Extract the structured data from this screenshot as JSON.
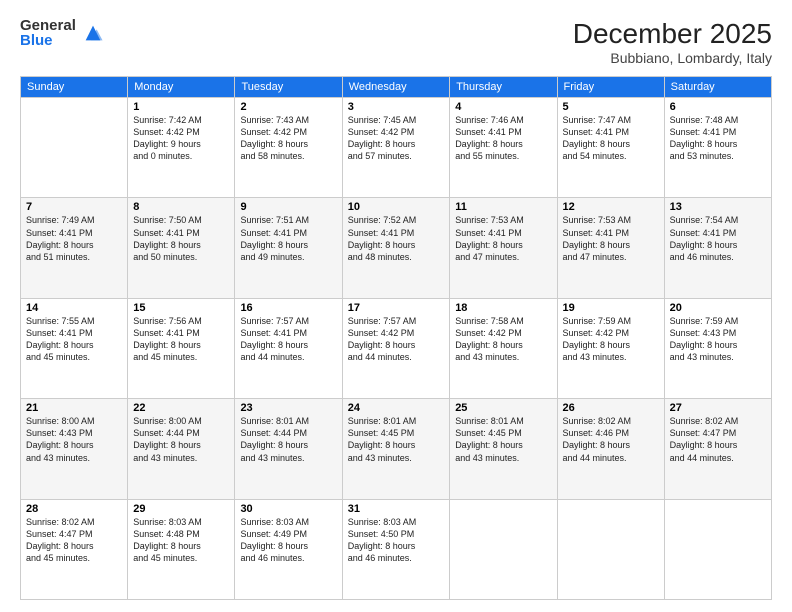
{
  "logo": {
    "general": "General",
    "blue": "Blue"
  },
  "header": {
    "month": "December 2025",
    "location": "Bubbiano, Lombardy, Italy"
  },
  "days": [
    "Sunday",
    "Monday",
    "Tuesday",
    "Wednesday",
    "Thursday",
    "Friday",
    "Saturday"
  ],
  "weeks": [
    [
      {
        "day": "",
        "sun": "",
        "mon": "",
        "tue": "",
        "wed": "",
        "thu": "",
        "fri": "",
        "sat": ""
      },
      {
        "num": "1",
        "lines": [
          "Sunrise: 7:42 AM",
          "Sunset: 4:42 PM",
          "Daylight: 9 hours",
          "and 0 minutes."
        ]
      },
      {
        "num": "2",
        "lines": [
          "Sunrise: 7:43 AM",
          "Sunset: 4:42 PM",
          "Daylight: 8 hours",
          "and 58 minutes."
        ]
      },
      {
        "num": "3",
        "lines": [
          "Sunrise: 7:45 AM",
          "Sunset: 4:42 PM",
          "Daylight: 8 hours",
          "and 57 minutes."
        ]
      },
      {
        "num": "4",
        "lines": [
          "Sunrise: 7:46 AM",
          "Sunset: 4:41 PM",
          "Daylight: 8 hours",
          "and 55 minutes."
        ]
      },
      {
        "num": "5",
        "lines": [
          "Sunrise: 7:47 AM",
          "Sunset: 4:41 PM",
          "Daylight: 8 hours",
          "and 54 minutes."
        ]
      },
      {
        "num": "6",
        "lines": [
          "Sunrise: 7:48 AM",
          "Sunset: 4:41 PM",
          "Daylight: 8 hours",
          "and 53 minutes."
        ]
      }
    ],
    [
      {
        "num": "7",
        "lines": [
          "Sunrise: 7:49 AM",
          "Sunset: 4:41 PM",
          "Daylight: 8 hours",
          "and 51 minutes."
        ]
      },
      {
        "num": "8",
        "lines": [
          "Sunrise: 7:50 AM",
          "Sunset: 4:41 PM",
          "Daylight: 8 hours",
          "and 50 minutes."
        ]
      },
      {
        "num": "9",
        "lines": [
          "Sunrise: 7:51 AM",
          "Sunset: 4:41 PM",
          "Daylight: 8 hours",
          "and 49 minutes."
        ]
      },
      {
        "num": "10",
        "lines": [
          "Sunrise: 7:52 AM",
          "Sunset: 4:41 PM",
          "Daylight: 8 hours",
          "and 48 minutes."
        ]
      },
      {
        "num": "11",
        "lines": [
          "Sunrise: 7:53 AM",
          "Sunset: 4:41 PM",
          "Daylight: 8 hours",
          "and 47 minutes."
        ]
      },
      {
        "num": "12",
        "lines": [
          "Sunrise: 7:53 AM",
          "Sunset: 4:41 PM",
          "Daylight: 8 hours",
          "and 47 minutes."
        ]
      },
      {
        "num": "13",
        "lines": [
          "Sunrise: 7:54 AM",
          "Sunset: 4:41 PM",
          "Daylight: 8 hours",
          "and 46 minutes."
        ]
      }
    ],
    [
      {
        "num": "14",
        "lines": [
          "Sunrise: 7:55 AM",
          "Sunset: 4:41 PM",
          "Daylight: 8 hours",
          "and 45 minutes."
        ]
      },
      {
        "num": "15",
        "lines": [
          "Sunrise: 7:56 AM",
          "Sunset: 4:41 PM",
          "Daylight: 8 hours",
          "and 45 minutes."
        ]
      },
      {
        "num": "16",
        "lines": [
          "Sunrise: 7:57 AM",
          "Sunset: 4:41 PM",
          "Daylight: 8 hours",
          "and 44 minutes."
        ]
      },
      {
        "num": "17",
        "lines": [
          "Sunrise: 7:57 AM",
          "Sunset: 4:42 PM",
          "Daylight: 8 hours",
          "and 44 minutes."
        ]
      },
      {
        "num": "18",
        "lines": [
          "Sunrise: 7:58 AM",
          "Sunset: 4:42 PM",
          "Daylight: 8 hours",
          "and 43 minutes."
        ]
      },
      {
        "num": "19",
        "lines": [
          "Sunrise: 7:59 AM",
          "Sunset: 4:42 PM",
          "Daylight: 8 hours",
          "and 43 minutes."
        ]
      },
      {
        "num": "20",
        "lines": [
          "Sunrise: 7:59 AM",
          "Sunset: 4:43 PM",
          "Daylight: 8 hours",
          "and 43 minutes."
        ]
      }
    ],
    [
      {
        "num": "21",
        "lines": [
          "Sunrise: 8:00 AM",
          "Sunset: 4:43 PM",
          "Daylight: 8 hours",
          "and 43 minutes."
        ]
      },
      {
        "num": "22",
        "lines": [
          "Sunrise: 8:00 AM",
          "Sunset: 4:44 PM",
          "Daylight: 8 hours",
          "and 43 minutes."
        ]
      },
      {
        "num": "23",
        "lines": [
          "Sunrise: 8:01 AM",
          "Sunset: 4:44 PM",
          "Daylight: 8 hours",
          "and 43 minutes."
        ]
      },
      {
        "num": "24",
        "lines": [
          "Sunrise: 8:01 AM",
          "Sunset: 4:45 PM",
          "Daylight: 8 hours",
          "and 43 minutes."
        ]
      },
      {
        "num": "25",
        "lines": [
          "Sunrise: 8:01 AM",
          "Sunset: 4:45 PM",
          "Daylight: 8 hours",
          "and 43 minutes."
        ]
      },
      {
        "num": "26",
        "lines": [
          "Sunrise: 8:02 AM",
          "Sunset: 4:46 PM",
          "Daylight: 8 hours",
          "and 44 minutes."
        ]
      },
      {
        "num": "27",
        "lines": [
          "Sunrise: 8:02 AM",
          "Sunset: 4:47 PM",
          "Daylight: 8 hours",
          "and 44 minutes."
        ]
      }
    ],
    [
      {
        "num": "28",
        "lines": [
          "Sunrise: 8:02 AM",
          "Sunset: 4:47 PM",
          "Daylight: 8 hours",
          "and 45 minutes."
        ]
      },
      {
        "num": "29",
        "lines": [
          "Sunrise: 8:03 AM",
          "Sunset: 4:48 PM",
          "Daylight: 8 hours",
          "and 45 minutes."
        ]
      },
      {
        "num": "30",
        "lines": [
          "Sunrise: 8:03 AM",
          "Sunset: 4:49 PM",
          "Daylight: 8 hours",
          "and 46 minutes."
        ]
      },
      {
        "num": "31",
        "lines": [
          "Sunrise: 8:03 AM",
          "Sunset: 4:50 PM",
          "Daylight: 8 hours",
          "and 46 minutes."
        ]
      },
      {
        "num": "",
        "lines": []
      },
      {
        "num": "",
        "lines": []
      },
      {
        "num": "",
        "lines": []
      }
    ]
  ]
}
